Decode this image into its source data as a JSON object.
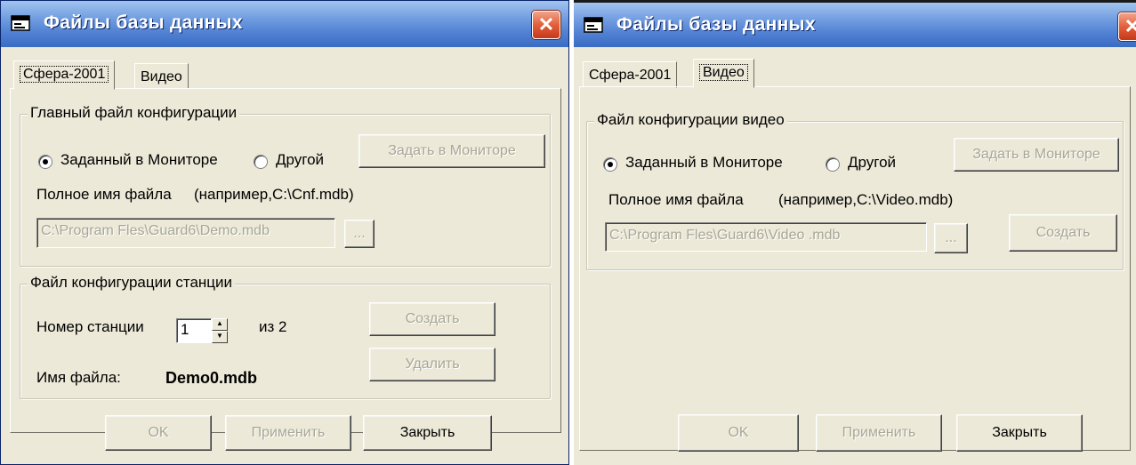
{
  "left_window": {
    "title": "Файлы базы данных",
    "close_glyph": "✕",
    "tabs": [
      {
        "label": "Сфера-2001"
      },
      {
        "label": "Видео"
      }
    ],
    "main_config": {
      "legend": "Главный файл конфигурации",
      "radio_monitor": "Заданный в Мониторе",
      "radio_other": "Другой",
      "set_in_monitor_button": "Задать в Мониторе",
      "fullname_label": "Полное имя файла",
      "example": "(например,C:\\Cnf.mdb)",
      "path_value": "C:\\Program Fles\\Guard6\\Demo.mdb",
      "browse_button": "..."
    },
    "station_config": {
      "legend": "Файл конфигурации станции",
      "station_number_label": "Номер станции",
      "station_number_value": "1",
      "of_label": "из  2",
      "create_button": "Создать",
      "delete_button": "Удалить",
      "filename_label": "Имя файла:",
      "filename_value": "Demo0.mdb"
    },
    "footer": {
      "ok": "OK",
      "apply": "Применить",
      "close": "Закрыть"
    }
  },
  "right_window": {
    "title": "Файлы базы данных",
    "close_glyph": "✕",
    "tabs": [
      {
        "label": "Сфера-2001"
      },
      {
        "label": "Видео"
      }
    ],
    "video_config": {
      "legend": "Файл конфигурации видео",
      "radio_monitor": "Заданный в Мониторе",
      "radio_other": "Другой",
      "set_in_monitor_button": "Задать в Мониторе",
      "fullname_label": "Полное имя файла",
      "example": "(например,C:\\Video.mdb)",
      "path_value": "C:\\Program Fles\\Guard6\\Video .mdb",
      "browse_button": "...",
      "create_button": "Создать"
    },
    "footer": {
      "ok": "OK",
      "apply": "Применить",
      "close": "Закрыть"
    }
  },
  "colors": {
    "window_bg": "#ece9d8",
    "title_blue": "#3a6cc4",
    "close_red": "#e35f3b",
    "disabled_text": "#a8a694"
  },
  "icons": {
    "window_icon": "database-window-icon",
    "close": "close-icon"
  }
}
